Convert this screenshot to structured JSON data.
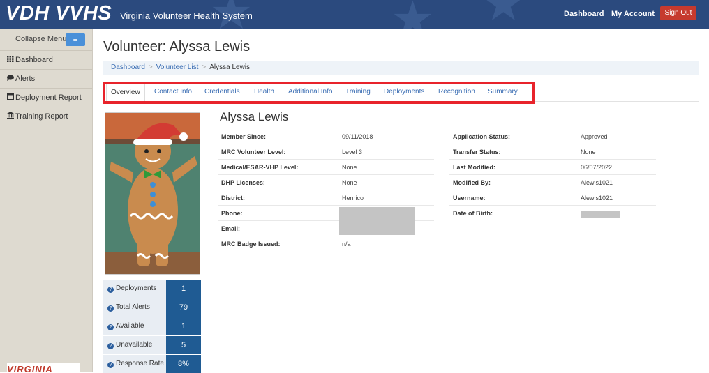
{
  "header": {
    "brand": "VDH VVHS",
    "subtitle": "Virginia Volunteer Health System",
    "nav": [
      "Dashboard",
      "My Account"
    ],
    "sign_out": "Sign Out"
  },
  "sidebar": {
    "collapse_label": "Collapse Menu",
    "collapse_icon": "≡",
    "items": [
      {
        "label": "Dashboard",
        "icon": "dashboard-icon"
      },
      {
        "label": "Alerts",
        "icon": "comment-icon"
      },
      {
        "label": "Deployment Report",
        "icon": "calendar-icon"
      },
      {
        "label": "Training Report",
        "icon": "institution-icon"
      }
    ],
    "logo_text": "VIRGINIA"
  },
  "page": {
    "title": "Volunteer: Alyssa Lewis",
    "breadcrumb": [
      "Dashboard",
      "Volunteer List",
      "Alyssa Lewis"
    ]
  },
  "tabs": [
    "Overview",
    "Contact Info",
    "Credentials",
    "Health",
    "Additional Info",
    "Training",
    "Deployments",
    "Recognition",
    "Summary"
  ],
  "stats": [
    {
      "label": "Deployments",
      "value": "1"
    },
    {
      "label": "Total Alerts",
      "value": "79"
    },
    {
      "label": "Available",
      "value": "1"
    },
    {
      "label": "Unavailable",
      "value": "5"
    },
    {
      "label": "Response Rate",
      "value": "8%"
    }
  ],
  "profile": {
    "name": "Alyssa Lewis",
    "left": [
      {
        "label": "Member Since:",
        "value": "09/11/2018"
      },
      {
        "label": "MRC Volunteer Level:",
        "value": "Level 3"
      },
      {
        "label": "Medical/ESAR-VHP Level:",
        "value": "None"
      },
      {
        "label": "DHP Licenses:",
        "value": "None"
      },
      {
        "label": "District:",
        "value": "Henrico"
      },
      {
        "label": "Phone:",
        "value": ""
      },
      {
        "label": "Email:",
        "value": ""
      },
      {
        "label": "MRC Badge Issued:",
        "value": "n/a"
      }
    ],
    "right": [
      {
        "label": "Application Status:",
        "value": "Approved"
      },
      {
        "label": "Transfer Status:",
        "value": "None"
      },
      {
        "label": "Last Modified:",
        "value": "06/07/2022"
      },
      {
        "label": "Modified By:",
        "value": "Alewis1021"
      },
      {
        "label": "Username:",
        "value": "Alewis1021"
      },
      {
        "label": "Date of Birth:",
        "value": ""
      }
    ]
  },
  "colors": {
    "header_bg": "#2b4a7e",
    "highlight": "#e8232b",
    "stat_value_bg": "#1f5b93",
    "link": "#3a6db3",
    "sign_out_bg": "#c63a2e"
  }
}
